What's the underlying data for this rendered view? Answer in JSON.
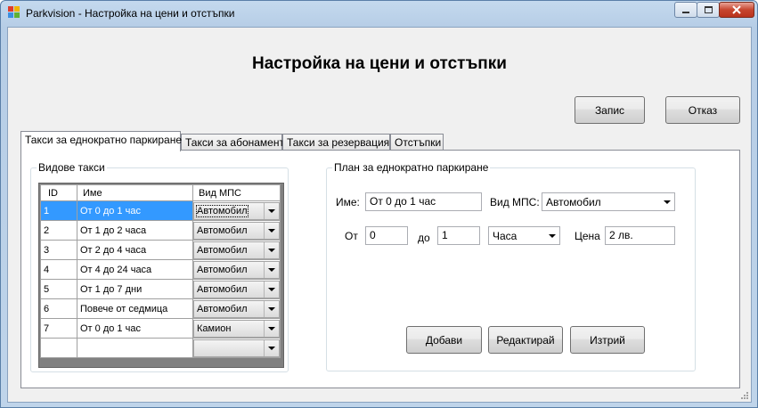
{
  "window": {
    "title": "Parkvision - Настройка на цени и отстъпки"
  },
  "heading": "Настройка на цени и отстъпки",
  "buttons": {
    "save": "Запис",
    "cancel": "Отказ",
    "add": "Добави",
    "edit": "Редактирай",
    "delete": "Изтрий"
  },
  "tabs": [
    {
      "label": "Такси за еднократно паркиране",
      "active": true
    },
    {
      "label": "Такси за абонамент",
      "active": false
    },
    {
      "label": "Такси за резервация",
      "active": false
    },
    {
      "label": "Отстъпки",
      "active": false
    }
  ],
  "fees_group": {
    "title": "Видове такси",
    "columns": [
      "ID",
      "Име",
      "Вид МПС"
    ],
    "rows": [
      {
        "id": "1",
        "name": "От 0 до 1 час",
        "type": "Автомобил",
        "selected": true
      },
      {
        "id": "2",
        "name": "От 1 до 2 часа",
        "type": "Автомобил"
      },
      {
        "id": "3",
        "name": "От 2 до 4 часа",
        "type": "Автомобил"
      },
      {
        "id": "4",
        "name": "От 4 до 24 часа",
        "type": "Автомобил"
      },
      {
        "id": "5",
        "name": "От 1 до 7 дни",
        "type": "Автомобил"
      },
      {
        "id": "6",
        "name": "Повече от седмица",
        "type": "Автомобил"
      },
      {
        "id": "7",
        "name": "От 0 до 1 час",
        "type": "Камион"
      },
      {
        "id": "",
        "name": "",
        "type": ""
      }
    ]
  },
  "plan_group": {
    "title": "План за еднократно паркиране",
    "name_label": "Име:",
    "name_value": "От 0 до 1 час",
    "vehicle_label": "Вид МПС:",
    "vehicle_value": "Автомобил",
    "from_label": "От",
    "from_value": "0",
    "to_label": "до",
    "to_value": "1",
    "unit_value": "Часа",
    "price_label": "Цена",
    "price_value": "2 лв."
  },
  "colors": {
    "selection": "#3399ff",
    "title_bar": "#c4d9ee",
    "close_button": "#c7452e"
  }
}
